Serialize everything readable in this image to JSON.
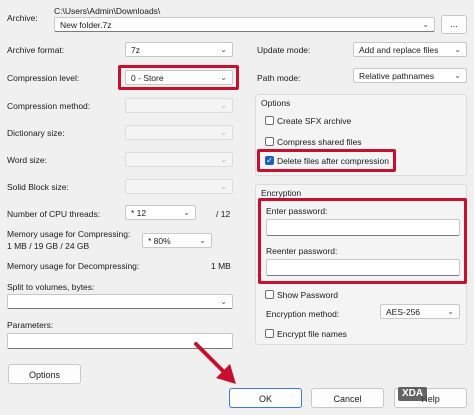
{
  "archive": {
    "label": "Archive:",
    "path": "C:\\Users\\Admin\\Downloads\\",
    "filename": "New folder.7z",
    "browse_label": "..."
  },
  "left": {
    "archive_format": {
      "label": "Archive format:",
      "value": "7z"
    },
    "compression_level": {
      "label": "Compression level:",
      "value": "0 - Store"
    },
    "compression_method": {
      "label": "Compression method:",
      "value": ""
    },
    "dictionary_size": {
      "label": "Dictionary size:",
      "value": ""
    },
    "word_size": {
      "label": "Word size:",
      "value": ""
    },
    "solid_block_size": {
      "label": "Solid Block size:",
      "value": ""
    },
    "cpu_threads": {
      "label": "Number of CPU threads:",
      "value": "* 12",
      "total": "/ 12"
    },
    "mem_compress": {
      "label": "Memory usage for Compressing:",
      "detail": "1 MB / 19 GB / 24 GB",
      "value": "* 80%"
    },
    "mem_decompress": {
      "label": "Memory usage for Decompressing:",
      "value": "1 MB"
    },
    "split_volumes": {
      "label": "Split to volumes, bytes:",
      "value": ""
    },
    "parameters": {
      "label": "Parameters:",
      "value": ""
    }
  },
  "right": {
    "update_mode": {
      "label": "Update mode:",
      "value": "Add and replace files"
    },
    "path_mode": {
      "label": "Path mode:",
      "value": "Relative pathnames"
    },
    "options": {
      "title": "Options",
      "create_sfx": {
        "label": "Create SFX archive",
        "checked": false
      },
      "compress_shared": {
        "label": "Compress shared files",
        "checked": false
      },
      "delete_after": {
        "label": "Delete files after compression",
        "checked": true
      }
    },
    "encryption": {
      "title": "Encryption",
      "enter_password": "Enter password:",
      "reenter_password": "Reenter password:",
      "show_password": "Show Password",
      "method_label": "Encryption method:",
      "method_value": "AES-256",
      "encrypt_names": "Encrypt file names"
    }
  },
  "buttons": {
    "options": "Options",
    "ok": "OK",
    "cancel": "Cancel",
    "help": "Help"
  },
  "icons": {
    "dropdown": "chevron-down-icon",
    "check": "checkmark-icon",
    "annotation": "red-arrow-icon"
  },
  "colors": {
    "highlight": "#c8102e",
    "accent": "#1f5fbf",
    "background": "#f0f0f0"
  },
  "watermark": "XDA"
}
